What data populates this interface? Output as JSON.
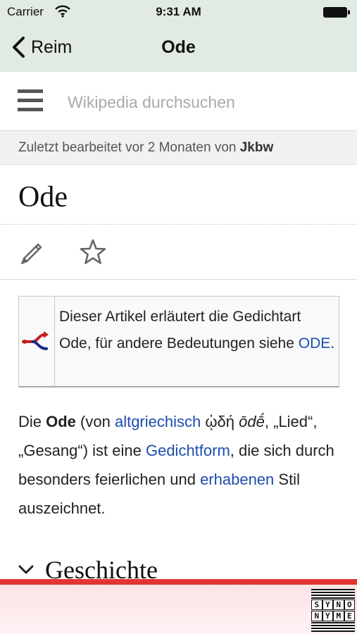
{
  "status_bar": {
    "carrier": "Carrier",
    "time": "9:31 AM"
  },
  "nav": {
    "back_label": "Reim",
    "title": "Ode"
  },
  "search": {
    "placeholder": "Wikipedia durchsuchen"
  },
  "last_modified": {
    "prefix": "Zuletzt bearbeitet vor 2 Monaten von ",
    "user": "Jkbw"
  },
  "article": {
    "title": "Ode",
    "hatnote": {
      "text": "Dieser Artikel erläutert die Gedichtart Ode, für andere Bedeutungen siehe ",
      "link": "ODE",
      "suffix": "."
    },
    "intro": {
      "p1": "Die ",
      "bold": "Ode",
      "p2": " (von ",
      "link_altgriechisch": "altgriechisch",
      "greek": " ᾠδή ",
      "translit": "ōdḗ",
      "p3": ", „Lied“, „Gesang“) ist eine ",
      "link_gedichtform": "Gedichtform",
      "p4": ", die sich durch besonders feierlichen und ",
      "link_erhabenen": "erhabenen",
      "p5": " Stil auszeichnet."
    },
    "section_title": "Geschichte"
  },
  "banner": {
    "logo_row1": [
      "S",
      "Y",
      "N",
      "O"
    ],
    "logo_row2": [
      "N",
      "Y",
      "M",
      "E"
    ]
  },
  "colors": {
    "nav_background": "#e1ebe1",
    "link": "#1f4cae",
    "banner_accent": "#e03530"
  },
  "icons": {
    "menu": "hamburger-icon",
    "edit": "pencil-icon",
    "watch": "star-icon",
    "disambiguation": "disambig-icon",
    "section": "chevron-down-icon"
  }
}
